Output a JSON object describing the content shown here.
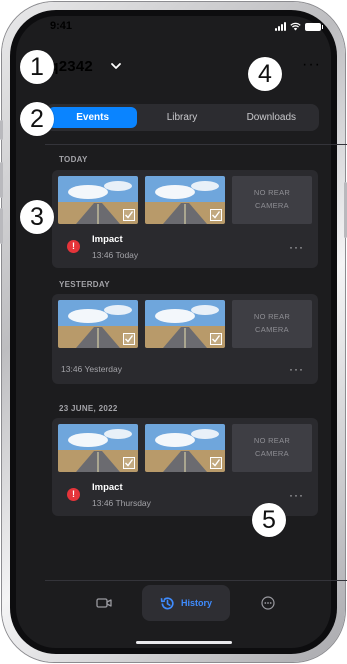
{
  "status_bar": {
    "time": "9:41"
  },
  "header": {
    "device_name": "iq2342",
    "more_label": "···"
  },
  "tabs": [
    {
      "label": "Events",
      "active": true
    },
    {
      "label": "Library",
      "active": false
    },
    {
      "label": "Downloads",
      "active": false
    }
  ],
  "sections": [
    {
      "label": "TODAY",
      "event": {
        "title": "Impact",
        "time": "13:46 Today",
        "alert": "!",
        "rear_camera": [
          "NO REAR",
          "CAMERA"
        ]
      }
    },
    {
      "label": "YESTERDAY",
      "event": {
        "title": "",
        "time": "13:46 Yesterday",
        "alert": "",
        "rear_camera": [
          "NO REAR",
          "CAMERA"
        ]
      }
    },
    {
      "label": "23 JUNE, 2022",
      "event": {
        "title": "Impact",
        "time": "13:46 Thursday",
        "alert": "!",
        "rear_camera": [
          "NO REAR",
          "CAMERA"
        ]
      }
    }
  ],
  "card_more_label": "···",
  "bottom_nav": {
    "history_label": "History"
  },
  "callouts": [
    "1",
    "2",
    "3",
    "4",
    "5"
  ],
  "colors": {
    "accent": "#0a84ff",
    "alert": "#e5343a",
    "background": "#1c1c1e",
    "card": "#2a2a2e"
  }
}
